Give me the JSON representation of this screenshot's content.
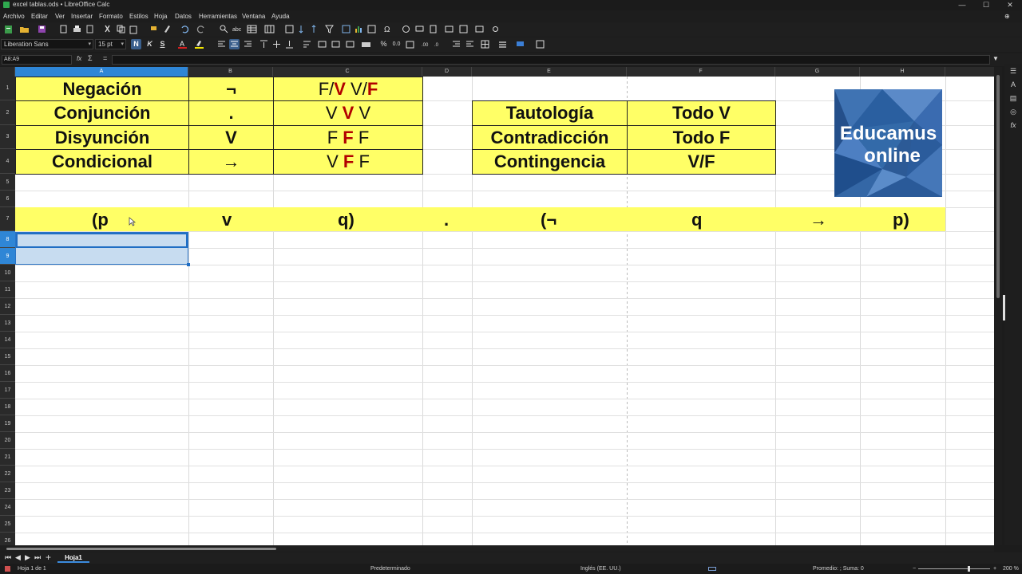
{
  "window": {
    "title": "excel tablas.ods • LibreOffice Calc",
    "controls": [
      "—",
      "☐",
      "✕"
    ]
  },
  "menu": [
    "Archivo",
    "Editar",
    "Ver",
    "Insertar",
    "Formato",
    "Estilos",
    "Hoja",
    "Datos",
    "Herramientas",
    "Ventana",
    "Ayuda"
  ],
  "toolbar": {
    "font_name": "Liberation Sans",
    "font_size": "15 pt",
    "bold": "N",
    "italic": "K",
    "underline": "S",
    "percent": "%",
    "decimal1": "0.0",
    "currency": "$",
    "text_color": "#d42020",
    "highlight_color": "#f2e600"
  },
  "formula_bar": {
    "name_box": "A8:A9",
    "fx": "fx",
    "sigma": "Σ",
    "equals": "=",
    "value": ""
  },
  "columns": [
    "A",
    "B",
    "C",
    "D",
    "E",
    "F",
    "G",
    "H"
  ],
  "rows": [
    "1",
    "2",
    "3",
    "4",
    "5",
    "6",
    "7",
    "8",
    "9",
    "10",
    "11",
    "12",
    "13",
    "14",
    "15",
    "16",
    "17",
    "18",
    "19",
    "20",
    "21",
    "22",
    "23",
    "24",
    "25",
    "26"
  ],
  "table_operators": [
    {
      "name": "Negación",
      "symbol": "¬",
      "truth": [
        "F/",
        "V",
        " V/",
        "F"
      ]
    },
    {
      "name": "Conjunción",
      "symbol": ".",
      "truth": [
        "V ",
        "V",
        " V",
        ""
      ]
    },
    {
      "name": "Disyunción",
      "symbol": "V",
      "truth": [
        "F ",
        "F",
        " F",
        ""
      ]
    },
    {
      "name": "Condicional",
      "symbol": "→",
      "truth": [
        "V ",
        "F",
        " F",
        ""
      ]
    }
  ],
  "table_results": [
    {
      "name": "Tautología",
      "value": "Todo V"
    },
    {
      "name": "Contradicción",
      "value": "Todo F"
    },
    {
      "name": "Contingencia",
      "value": "V/F"
    }
  ],
  "formula_row": [
    "(p",
    "v",
    "q)",
    ".",
    "(¬",
    "q",
    "→",
    "p)"
  ],
  "logo": {
    "line1": "Educamus",
    "line2": "online"
  },
  "sheet_tabs": [
    "Hoja1"
  ],
  "status": {
    "sheet": "Hoja 1 de 1",
    "style": "Predeterminado",
    "language": "Inglés (EE. UU.)",
    "summary": "Promedio: ; Suma: 0",
    "zoom": "200 %"
  },
  "colors": {
    "cell_yellow": "#ffff66",
    "accent_red": "#b10000",
    "selection": "#2f86d6"
  }
}
